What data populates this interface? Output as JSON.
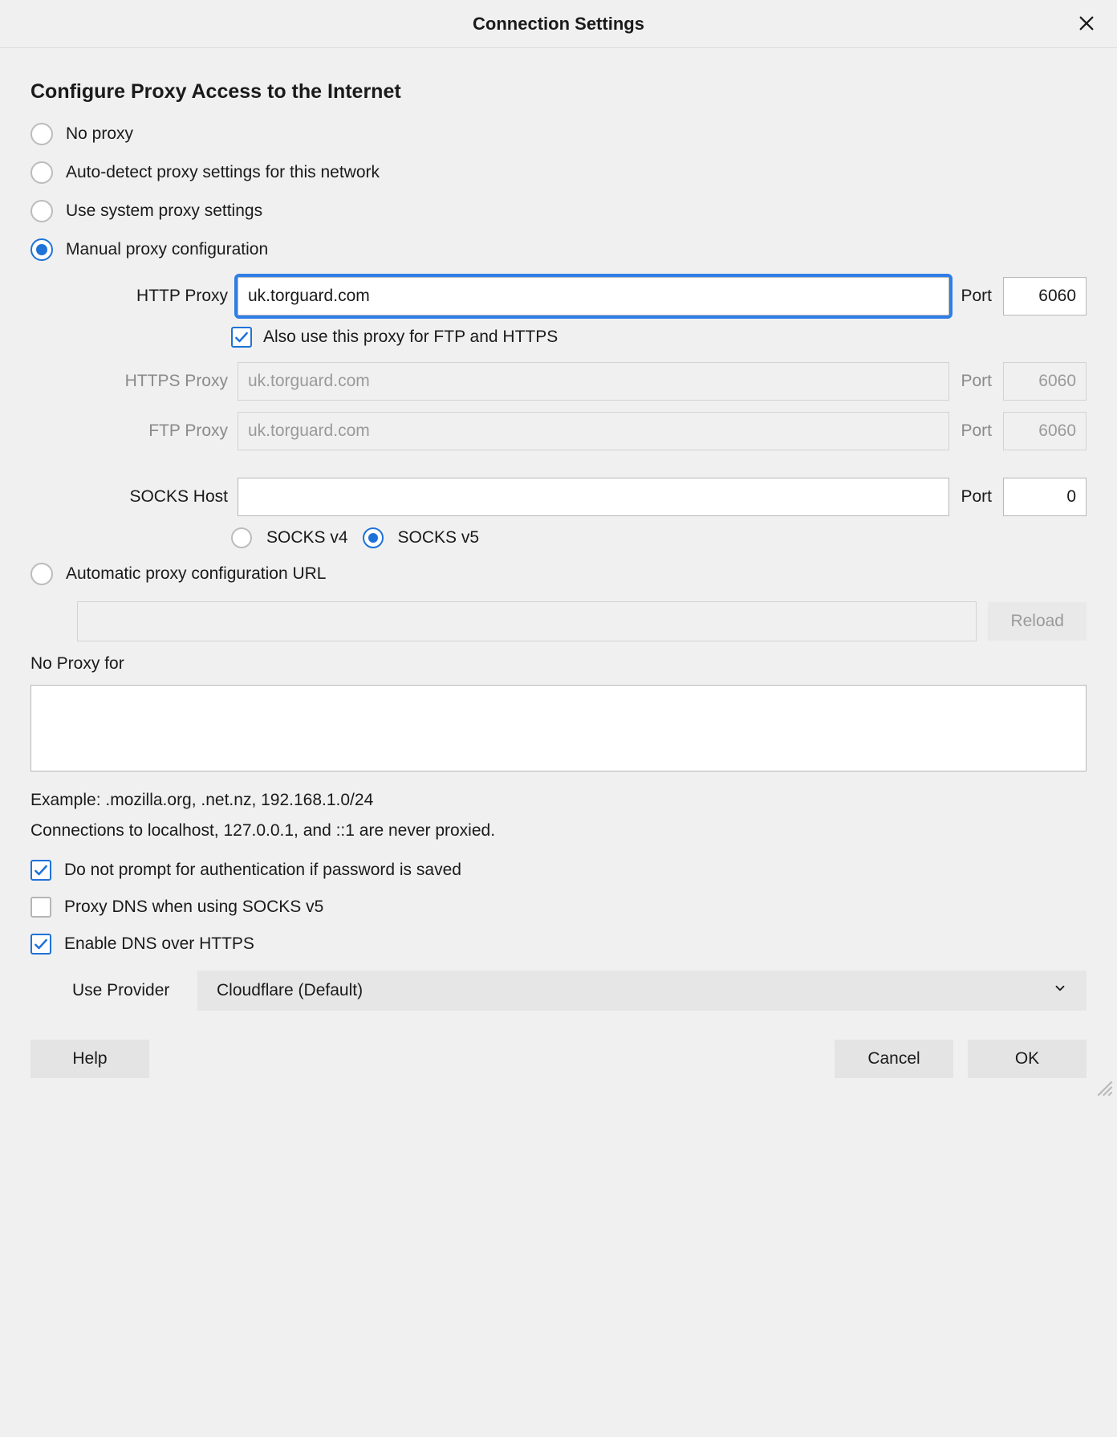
{
  "title": "Connection Settings",
  "heading": "Configure Proxy Access to the Internet",
  "radio": {
    "no_proxy": "No proxy",
    "auto_detect": "Auto-detect proxy settings for this network",
    "system": "Use system proxy settings",
    "manual": "Manual proxy configuration",
    "autoconf": "Automatic proxy configuration URL",
    "selected": "manual"
  },
  "fields": {
    "http_label": "HTTP Proxy",
    "http_value": "uk.torguard.com",
    "http_port": "6060",
    "also_use_label": "Also use this proxy for FTP and HTTPS",
    "also_use_checked": true,
    "https_label": "HTTPS Proxy",
    "https_value": "uk.torguard.com",
    "https_port": "6060",
    "ftp_label": "FTP Proxy",
    "ftp_value": "uk.torguard.com",
    "ftp_port": "6060",
    "socks_label": "SOCKS Host",
    "socks_value": "",
    "socks_port": "0",
    "port_label": "Port",
    "socks_v4": "SOCKS v4",
    "socks_v5": "SOCKS v5",
    "socks_version_selected": "v5"
  },
  "autoconf": {
    "url_value": "",
    "reload": "Reload"
  },
  "noproxy": {
    "label": "No Proxy for",
    "value": "",
    "example": "Example: .mozilla.org, .net.nz, 192.168.1.0/24",
    "note": "Connections to localhost, 127.0.0.1, and ::1 are never proxied."
  },
  "checks": {
    "no_prompt_label": "Do not prompt for authentication if password is saved",
    "no_prompt_checked": true,
    "proxy_dns_label": "Proxy DNS when using SOCKS v5",
    "proxy_dns_checked": false,
    "doh_label": "Enable DNS over HTTPS",
    "doh_checked": true
  },
  "provider": {
    "label": "Use Provider",
    "value": "Cloudflare (Default)"
  },
  "buttons": {
    "help": "Help",
    "cancel": "Cancel",
    "ok": "OK"
  }
}
